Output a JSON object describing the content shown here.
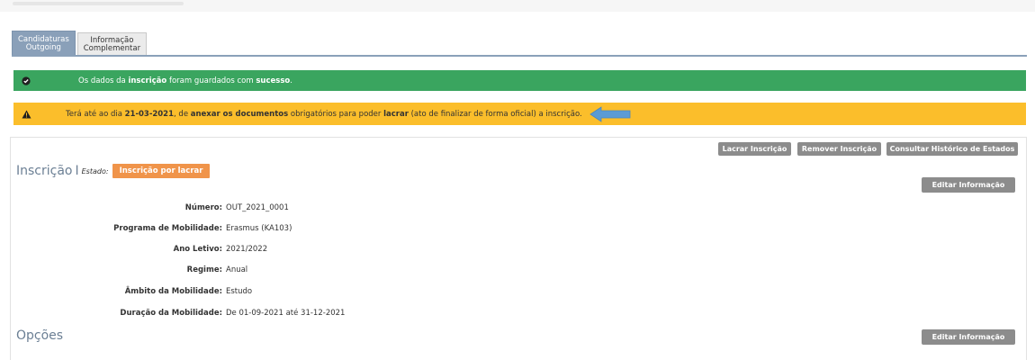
{
  "tabs": [
    {
      "line1": "Candidaturas",
      "line2": "Outgoing"
    },
    {
      "line1": "Informação",
      "line2": "Complementar"
    }
  ],
  "alerts": {
    "success": {
      "pre": "Os dados da ",
      "b1": "inscrição",
      "mid": " foram guardados com ",
      "b2": "sucesso",
      "post": "."
    },
    "warning": {
      "pre": "Terá até ao dia ",
      "b1": "21-03-2021",
      "mid1": ", de ",
      "b2": "anexar os documentos",
      "mid2": " obrigatórios para poder ",
      "b3": "lacrar",
      "post": " (ato de finalizar de forma oficial) a inscrição."
    }
  },
  "actions": {
    "lacrar": "Lacrar Inscrição",
    "remover": "Remover Inscrição",
    "historico": "Consultar Histórico de Estados",
    "editar": "Editar Informação"
  },
  "inscricao": {
    "title": "Inscrição",
    "separator": "I",
    "estado_label": "Estado:",
    "estado_value": "Inscrição por lacrar"
  },
  "fields": [
    {
      "label": "Número:",
      "value": "OUT_2021_0001"
    },
    {
      "label": "Programa de Mobilidade:",
      "value": "Erasmus (KA103)"
    },
    {
      "label": "Ano Letivo:",
      "value": "2021/2022"
    },
    {
      "label": "Regime:",
      "value": "Anual"
    },
    {
      "label": "Âmbito da Mobilidade:",
      "value": "Estudo"
    },
    {
      "label": "Duração da Mobilidade:",
      "value": "De 01-09-2021 até 31-12-2021"
    }
  ],
  "opcoes": {
    "title": "Opções",
    "editar": "Editar Informação"
  },
  "colors": {
    "success": "#3aa55f",
    "warning": "#fbbe2b",
    "badge": "#f0944a",
    "tab_active": "#8aa0b9",
    "button": "#8c8c8c"
  }
}
